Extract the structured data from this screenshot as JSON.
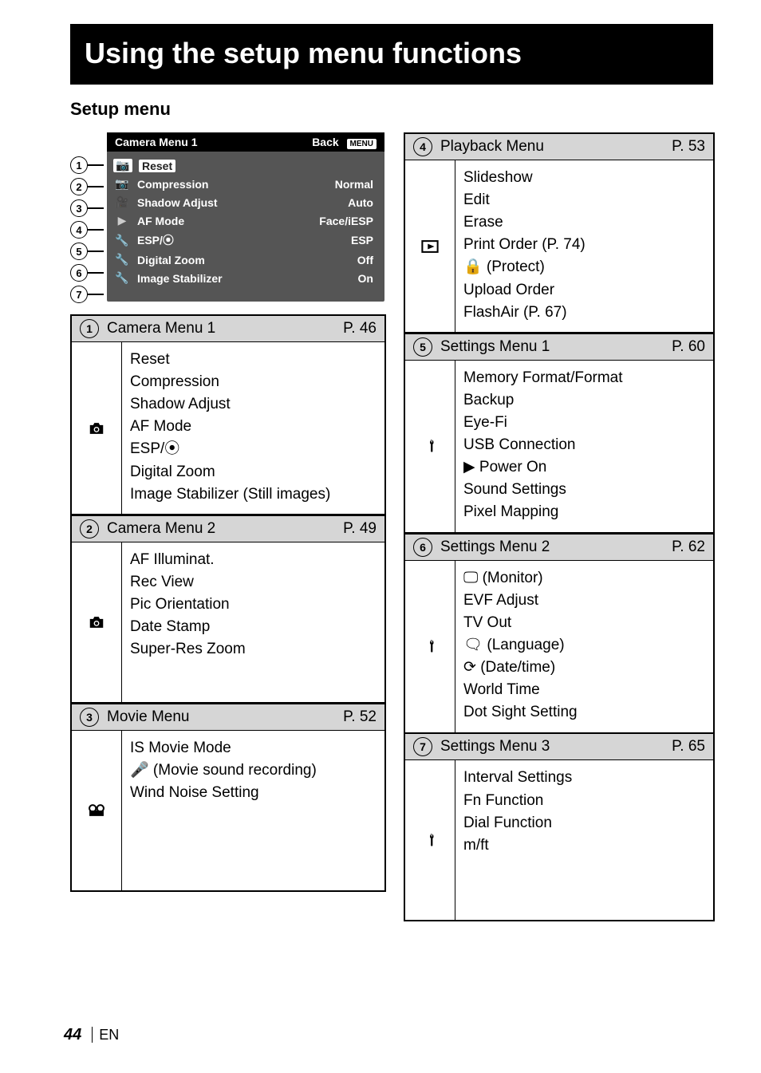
{
  "title_bar": "Using the setup menu functions",
  "subtitle": "Setup menu",
  "lcd": {
    "header_title": "Camera Menu 1",
    "header_back": "Back",
    "header_badge": "MENU",
    "rows": [
      {
        "label": "Reset",
        "value": ""
      },
      {
        "label": "Compression",
        "value": "Normal"
      },
      {
        "label": "Shadow Adjust",
        "value": "Auto"
      },
      {
        "label": "AF Mode",
        "value": "Face/iESP"
      },
      {
        "label": "ESP/⦿",
        "value": "ESP"
      },
      {
        "label": "Digital Zoom",
        "value": "Off"
      },
      {
        "label": "Image Stabilizer",
        "value": "On"
      }
    ],
    "side_icons": [
      "📷",
      "📷",
      "🎥",
      "▶",
      "🔧",
      "🔧",
      "🔧"
    ]
  },
  "callout_numbers": [
    "1",
    "2",
    "3",
    "4",
    "5",
    "6",
    "7"
  ],
  "sections_left": [
    {
      "num": "1",
      "name": "Camera Menu 1",
      "page": "P. 46",
      "icon": "camera",
      "items": [
        "Reset",
        "Compression",
        "Shadow Adjust",
        "AF Mode",
        "ESP/⦿",
        "Digital Zoom",
        "Image Stabilizer (Still images)"
      ]
    },
    {
      "num": "2",
      "name": "Camera Menu 2",
      "page": "P. 49",
      "icon": "camera",
      "items": [
        "AF Illuminat.",
        "Rec View",
        "Pic Orientation",
        "Date Stamp",
        "Super-Res Zoom"
      ]
    },
    {
      "num": "3",
      "name": "Movie Menu",
      "page": "P. 52",
      "icon": "movie",
      "items": [
        "IS Movie Mode",
        "🎤 (Movie sound recording)",
        "Wind Noise Setting"
      ]
    }
  ],
  "sections_right": [
    {
      "num": "4",
      "name": "Playback Menu",
      "page": "P. 53",
      "icon": "play",
      "items": [
        "Slideshow",
        "Edit",
        "Erase",
        "Print Order (P. 74)",
        "🔒 (Protect)",
        "Upload Order",
        "FlashAir (P. 67)"
      ]
    },
    {
      "num": "5",
      "name": "Settings Menu 1",
      "page": "P. 60",
      "icon": "wrench",
      "items": [
        "Memory Format/Format",
        "Backup",
        "Eye-Fi",
        "USB Connection",
        "▶ Power On",
        "Sound Settings",
        "Pixel Mapping"
      ]
    },
    {
      "num": "6",
      "name": "Settings Menu 2",
      "page": "P. 62",
      "icon": "wrench",
      "items": [
        "🖵 (Monitor)",
        "EVF Adjust",
        "TV Out",
        "🗨 (Language)",
        "⟳ (Date/time)",
        "World Time",
        "Dot Sight Setting"
      ]
    },
    {
      "num": "7",
      "name": "Settings Menu 3",
      "page": "P. 65",
      "icon": "wrench",
      "items": [
        "Interval Settings",
        "Fn Function",
        "Dial Function",
        "m/ft"
      ]
    }
  ],
  "footer": {
    "page_number": "44",
    "lang": "EN"
  }
}
